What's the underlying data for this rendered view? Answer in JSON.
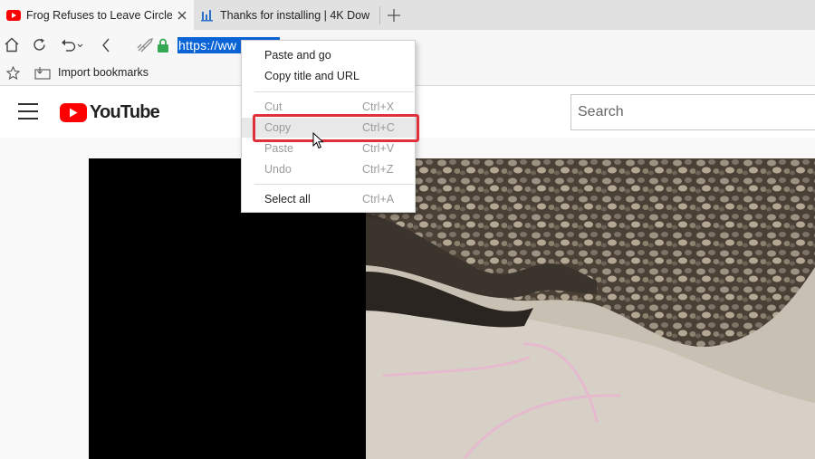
{
  "tabs": [
    {
      "title": "Frog Refuses to Leave Circle - ",
      "favicon": "youtube-favicon-icon",
      "active": true
    },
    {
      "title": "Thanks for installing | 4K Dow",
      "favicon": "4k-download-favicon-icon",
      "active": false
    }
  ],
  "address_bar": {
    "url": "https://ww                                              iPzIlx0"
  },
  "bookmarks_bar": {
    "import_label": "Import bookmarks"
  },
  "youtube": {
    "logo_text": "YouTube",
    "search_placeholder": "Search"
  },
  "context_menu": {
    "items": [
      {
        "label": "Paste and go",
        "shortcut": "",
        "enabled": true
      },
      {
        "label": "Copy title and URL",
        "shortcut": "",
        "enabled": true
      },
      {
        "label": "Cut",
        "shortcut": "Ctrl+X",
        "enabled": false
      },
      {
        "label": "Copy",
        "shortcut": "Ctrl+C",
        "enabled": false
      },
      {
        "label": "Paste",
        "shortcut": "Ctrl+V",
        "enabled": false
      },
      {
        "label": "Undo",
        "shortcut": "Ctrl+Z",
        "enabled": false
      },
      {
        "label": "Select all",
        "shortcut": "Ctrl+A",
        "enabled": true
      }
    ]
  },
  "colors": {
    "selection": "#0a64d6",
    "highlight_border": "#e0303a",
    "youtube_red": "#ff0000"
  }
}
